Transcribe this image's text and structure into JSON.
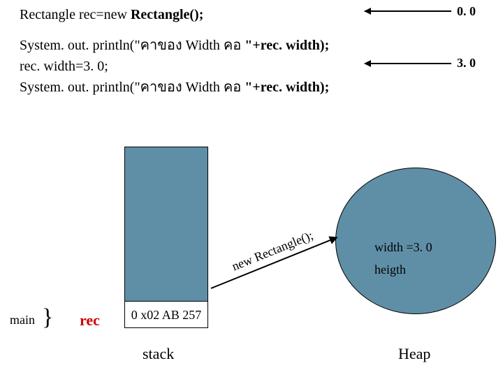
{
  "code": {
    "l1a": "Rectangle  rec=new ",
    "l1b": "Rectangle();",
    "l2a": "System. out. println(\"คาของ    Width คอ  ",
    "l2b": "\"+rec. width);",
    "l3": " rec. width=3. 0;",
    "l4a": "System. out. println(\"คาของ    Width คอ  ",
    "l4b": "\"+rec. width);"
  },
  "values": {
    "initial": "0. 0",
    "after": "3. 0"
  },
  "stack": {
    "main": "main",
    "brace": "}",
    "rec": "rec",
    "addr": "0 x02 AB 257",
    "caption": "stack"
  },
  "heap": {
    "width": "width =3. 0",
    "height": "heigth",
    "caption": "Heap"
  },
  "arrowLabel": "new Rectangle();"
}
